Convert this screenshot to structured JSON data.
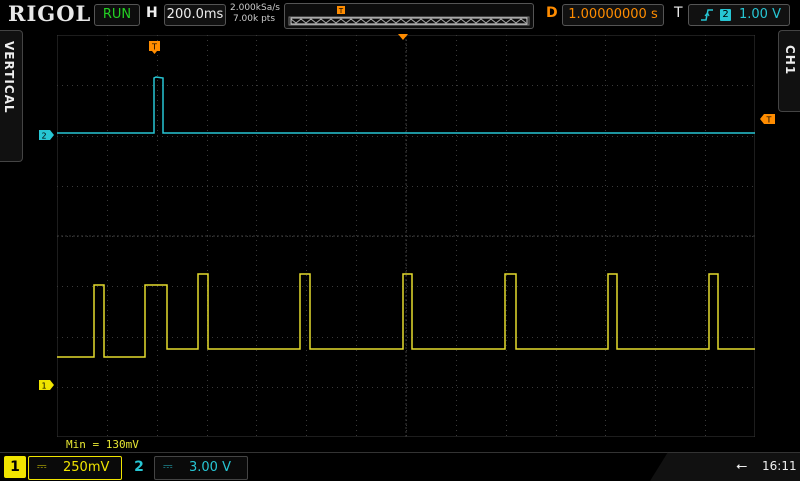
{
  "brand": "RIGOL",
  "status": "RUN",
  "horizontal": {
    "label": "H",
    "timebase": "200.0ms",
    "sample_rate": "2.000kSa/s",
    "memory_depth": "7.00k pts"
  },
  "delay": {
    "label": "D",
    "value": "1.00000000 s"
  },
  "trigger": {
    "label": "T",
    "source": "2",
    "level": "1.00 V",
    "color": "#27c6d4"
  },
  "side_tabs": {
    "left": "VERTICAL",
    "right": "CH1"
  },
  "measurement": "Min = 130mV",
  "channels": [
    {
      "number": "1",
      "coupling": "⎓",
      "scale": "250mV",
      "color": "#f0e400"
    },
    {
      "number": "2",
      "coupling": "⎓",
      "scale": "3.00 V",
      "color": "#27c6d4"
    }
  ],
  "clock": "16:11",
  "icons": {
    "usb": "usb-icon",
    "trigger_edge": "rising-edge-icon",
    "trigger_marker": "trigger-marker-icon"
  },
  "colors": {
    "ch1": "#f0e400",
    "ch2": "#27c6d4",
    "accent": "#ff8c00",
    "grid": "#3a3a3a"
  }
}
